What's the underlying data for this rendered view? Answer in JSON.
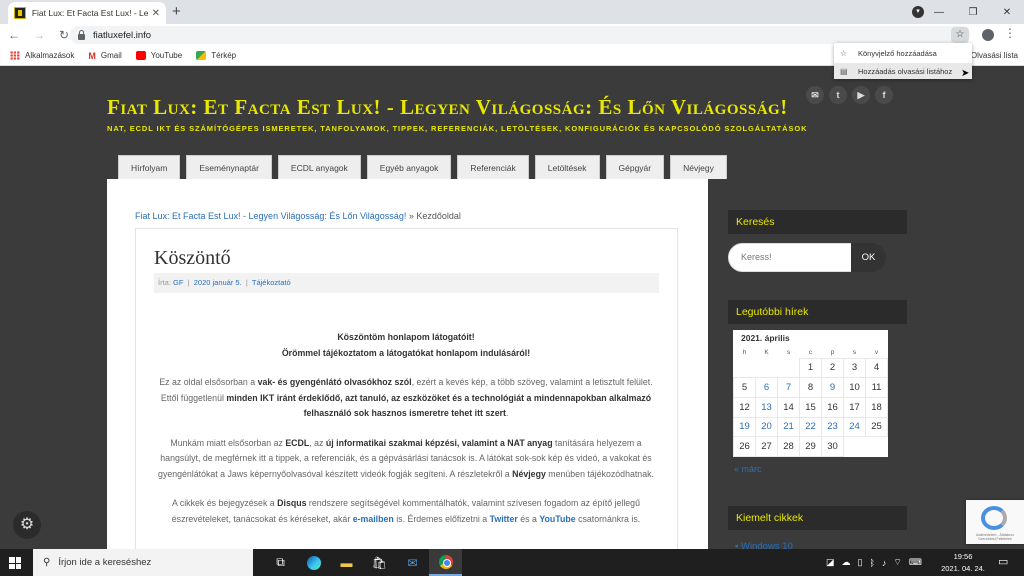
{
  "browser": {
    "tab_title": "Fiat Lux: Et Facta Est Lux! - Legyen",
    "tab_close": "✕",
    "new_tab": "+",
    "url": "fiatluxefel.info",
    "bookmarks": [
      {
        "label": "Alkalmazások",
        "icon": "apps-icon"
      },
      {
        "label": "Gmail",
        "icon": "gmail-icon"
      },
      {
        "label": "YouTube",
        "icon": "youtube-icon"
      },
      {
        "label": "Térkép",
        "icon": "maps-icon"
      }
    ],
    "reading_list": "Olvasási lista",
    "dropdown": [
      {
        "label": "Könyvjelző hozzáadása",
        "icon": "star-icon"
      },
      {
        "label": "Hozzáadás olvasási listához",
        "icon": "reading-list-icon"
      }
    ]
  },
  "site": {
    "title": "Fiat Lux: Et Facta Est Lux! - Legyen Világosság: És Lőn Világosság!",
    "tagline": "NAT, ECDL IKT és számítógépes ismeretek, tanfolyamok, tippek, referenciák, letöltések, konfigurációk és kapcsolódó szolgáltatások",
    "nav": [
      "Hírfolyam",
      "Eseménynaptár",
      "ECDL anyagok",
      "Egyéb anyagok",
      "Referenciák",
      "Letöltések",
      "Gépgyár",
      "Névjegy"
    ]
  },
  "breadcrumb": {
    "home": "Fiat Lux: Et Facta Est Lux! - Legyen Világosság: És Lőn Világosság!",
    "separator": "»",
    "current": "Kezdőoldal"
  },
  "post": {
    "title": "Köszöntő",
    "meta_prefix": "Írta:",
    "author": "GF",
    "sep": "|",
    "date": "2020 január 5.",
    "category": "Tájékoztató",
    "welcome_1": "Köszöntöm honlapom látogatóit!",
    "welcome_2": "Örömmel tájékoztatom a látogatókat honlapom indulásáról!",
    "p2": {
      "t1": "Ez az oldal elsősorban a ",
      "b1": "vak- és gyengénlátó olvasókhoz szól",
      "t2": ", ezért a kevés kép, a több szöveg, valamint a letisztult felület. Ettől függetlenül ",
      "b2": "minden IKT iránt érdeklődő, azt tanuló, az eszközöket és a technológiát a mindennapokban alkalmazó felhasználó sok hasznos ismeretre tehet itt szert",
      "t3": "."
    },
    "p3": {
      "t1": "Munkám miatt elsősorban az ",
      "b1": "ECDL",
      "t2": ", az ",
      "b2": "új informatikai szakmai képzési, valamint a NAT anyag",
      "t3": " tanítására helyezem a hangsúlyt, de megférnek itt a tippek, a referenciák, és a gépvásárlási tanácsok is. A látókat sok-sok kép és videó, a vakokat és gyengénlátókat a Jaws képernyőolvasóval készített videók fogják segíteni. A részletekről a ",
      "b3": "Névjegy",
      "t4": " menüben tájékozódhatnak."
    },
    "p4": {
      "t1": "A cikkek és bejegyzések a ",
      "b1": "Disqus",
      "t2": " rendszere segítségével kommentálhatók, valamint szívesen fogadom az építő jellegű észrevételeket, tanácsokat és kéréseket, akár ",
      "l1": "e-mailben",
      "t3": " is. Érdemes előfizetni a ",
      "l2": "Twitter",
      "t4": " és a ",
      "l3": "YouTube",
      "t5": " csatornánkra is."
    }
  },
  "sidebar": {
    "search_title": "Keresés",
    "search_placeholder": "Keress!",
    "search_button": "OK",
    "news_title": "Legutóbbi hírek",
    "calendar": {
      "caption": "2021. április",
      "weekdays": [
        "h",
        "K",
        "s",
        "c",
        "p",
        "s",
        "v"
      ],
      "weeks": [
        [
          "",
          "",
          "",
          "1",
          "2",
          "3",
          "4"
        ],
        [
          "5",
          "6",
          "7",
          "8",
          "9",
          "10",
          "11"
        ],
        [
          "12",
          "13",
          "14",
          "15",
          "16",
          "17",
          "18"
        ],
        [
          "19",
          "20",
          "21",
          "22",
          "23",
          "24",
          "25"
        ],
        [
          "26",
          "27",
          "28",
          "29",
          "30",
          "",
          ""
        ]
      ],
      "linked_days": [
        "6",
        "7",
        "9",
        "13",
        "19",
        "20",
        "21",
        "22",
        "23",
        "24"
      ],
      "prev": "« márc"
    },
    "featured_title": "Kiemelt cikkek",
    "featured_first": "Windows 10"
  },
  "recaptcha": {
    "text": "Adatvédelem - Általános Szerződési Feltételek"
  },
  "taskbar": {
    "search_placeholder": "Írjon ide a kereséshez",
    "time": "19:56",
    "date": "2021. 04. 24."
  }
}
